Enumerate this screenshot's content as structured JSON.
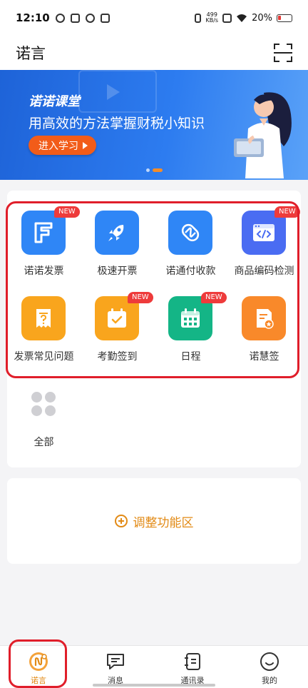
{
  "status_bar": {
    "time": "12:10",
    "net_speed_value": "499",
    "net_speed_unit": "KB/s",
    "battery": "20%"
  },
  "header": {
    "title": "诺言",
    "scan_icon": "scan-icon"
  },
  "banner": {
    "brand": "诺诺课堂",
    "slogan": "用高效的方法掌握财税小知识",
    "cta": "进入学习",
    "active_slide": 2,
    "slide_count": 2
  },
  "functions": [
    {
      "label": "诺诺发票",
      "icon": "invoice-icon",
      "color": "#2f86f6",
      "badge": "NEW"
    },
    {
      "label": "极速开票",
      "icon": "rocket-icon",
      "color": "#2f86f6",
      "badge": ""
    },
    {
      "label": "诺通付收款",
      "icon": "payment-icon",
      "color": "#2f86f6",
      "badge": ""
    },
    {
      "label": "商品编码检测",
      "icon": "code-check-icon",
      "color": "#4a6cf2",
      "badge": "NEW"
    },
    {
      "label": "发票常见问题",
      "icon": "faq-icon",
      "color": "#f9a51d",
      "badge": ""
    },
    {
      "label": "考勤签到",
      "icon": "attendance-icon",
      "color": "#f9a51d",
      "badge": "NEW"
    },
    {
      "label": "日程",
      "icon": "calendar-icon",
      "color": "#14b586",
      "badge": "NEW"
    },
    {
      "label": "诺慧签",
      "icon": "sign-icon",
      "color": "#f9892a",
      "badge": ""
    }
  ],
  "all": {
    "label": "全部",
    "icon": "grid-dots-icon"
  },
  "adjust": {
    "label": "调整功能区",
    "icon": "plus-circle-icon"
  },
  "tabs": [
    {
      "label": "诺言",
      "icon": "home-icon",
      "active": true
    },
    {
      "label": "消息",
      "icon": "message-icon",
      "active": false
    },
    {
      "label": "通讯录",
      "icon": "contacts-icon",
      "active": false
    },
    {
      "label": "我的",
      "icon": "profile-icon",
      "active": false
    }
  ],
  "colors": {
    "accent": "#e28a15",
    "primary_blue": "#2f86f6",
    "badge_red": "#ee3b3b",
    "highlight_frame": "#e01e2a"
  }
}
